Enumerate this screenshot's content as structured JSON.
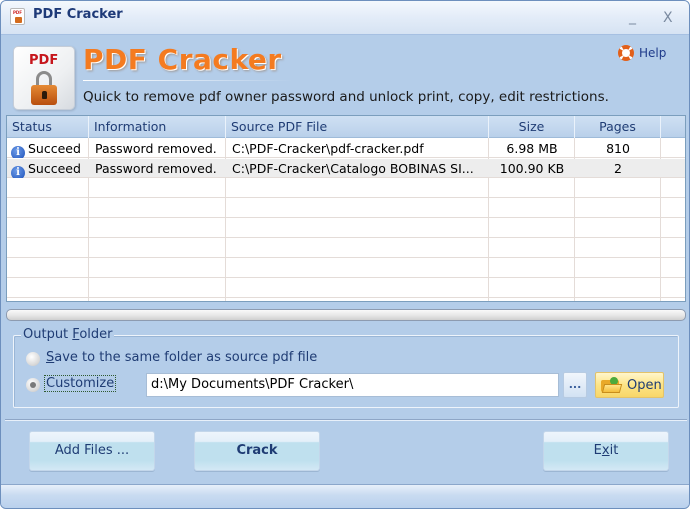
{
  "window": {
    "title": "PDF Cracker",
    "minimize_glyph": "_",
    "close_glyph": "X"
  },
  "header": {
    "logo_text": "PDF",
    "app_title": "PDF Cracker",
    "subtitle": "Quick to remove pdf owner password and unlock print, copy, edit restrictions.",
    "help_label": "Help"
  },
  "grid": {
    "columns": [
      {
        "label": "Status"
      },
      {
        "label": "Information"
      },
      {
        "label": "Source PDF File"
      },
      {
        "label": "Size"
      },
      {
        "label": "Pages"
      }
    ],
    "rows": [
      {
        "status": "Succeed",
        "info": "Password removed.",
        "file": "C:\\PDF-Cracker\\pdf-cracker.pdf",
        "size": "6.98 MB",
        "pages": "810"
      },
      {
        "status": "Succeed",
        "info": "Password removed.",
        "file": "C:\\PDF-Cracker\\Catalogo BOBINAS SI...",
        "size": "100.90 KB",
        "pages": "2"
      }
    ],
    "info_glyph": "i"
  },
  "progress": {
    "value_percent": 0
  },
  "output": {
    "legend_prefix": "Output ",
    "legend_accel": "F",
    "legend_rest": "older",
    "option_same_accel": "S",
    "option_same_rest": "ave to the same folder as source pdf file",
    "option_custom": "Customize",
    "selected": "Customize",
    "path_value": "d:\\My Documents\\PDF Cracker\\",
    "browse_label": "...",
    "open_label": "Open"
  },
  "buttons": {
    "add_files": "Add Files ...",
    "crack": "Crack",
    "exit_pre": "E",
    "exit_accel": "x",
    "exit_post": "it"
  }
}
